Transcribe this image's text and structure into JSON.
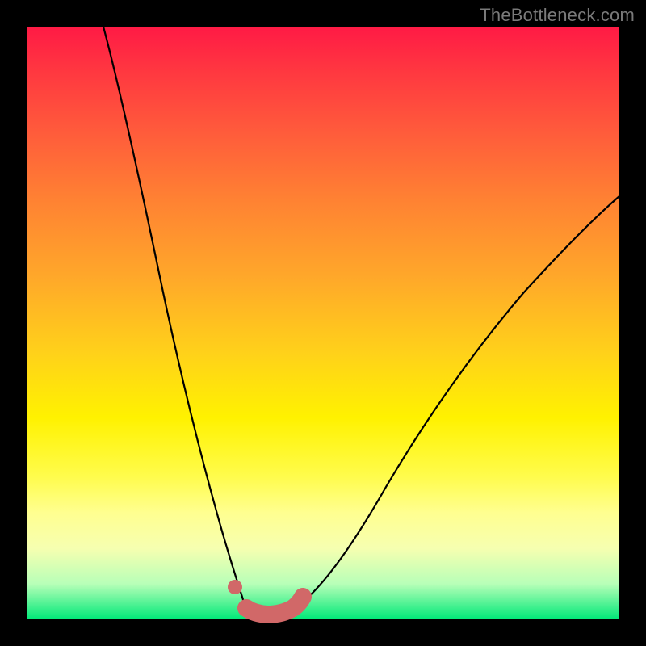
{
  "watermark": "TheBottleneck.com",
  "chart_data": {
    "type": "line",
    "title": "",
    "xlabel": "",
    "ylabel": "",
    "xlim": [
      0,
      100
    ],
    "ylim": [
      0,
      100
    ],
    "grid": false,
    "legend": false,
    "background": "rainbow-gradient-red-to-green",
    "series": [
      {
        "name": "left-branch",
        "color": "#000000",
        "x": [
          13,
          16,
          19,
          22,
          25,
          27,
          29,
          31,
          33,
          35,
          36.5
        ],
        "y": [
          100,
          88,
          73,
          58,
          44,
          34,
          25,
          17,
          10,
          5,
          2
        ]
      },
      {
        "name": "bottom-valley",
        "color": "#000000",
        "x": [
          36.5,
          38,
          40,
          42,
          44,
          46
        ],
        "y": [
          2,
          1.2,
          0.8,
          0.8,
          1.2,
          2
        ]
      },
      {
        "name": "right-branch",
        "color": "#000000",
        "x": [
          46,
          50,
          55,
          60,
          66,
          73,
          81,
          90,
          100
        ],
        "y": [
          2,
          6,
          14,
          24,
          35,
          47,
          58,
          67,
          75
        ]
      }
    ],
    "highlights": [
      {
        "name": "optimal-dot",
        "type": "point",
        "color": "#d16868",
        "x": 35,
        "y": 5
      },
      {
        "name": "optimal-range",
        "type": "path",
        "color": "#d16868",
        "x": [
          37,
          38.5,
          40.5,
          43,
          45,
          46
        ],
        "y": [
          1.2,
          0.9,
          0.8,
          0.9,
          1.4,
          2.4
        ]
      }
    ]
  }
}
